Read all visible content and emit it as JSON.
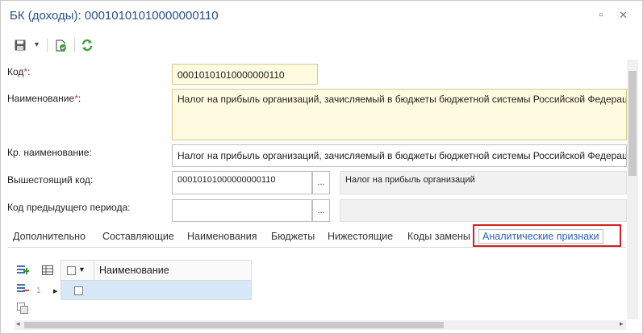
{
  "window": {
    "title": "БК (доходы): 00010101010000000110",
    "restore_glyph": "▫",
    "close_glyph": "✕"
  },
  "toolbar": {
    "save_icon": "save-icon",
    "dropdown_glyph": "▾",
    "approve_icon": "document-check-icon",
    "refresh_icon": "refresh-icon"
  },
  "form": {
    "code": {
      "label": "Код",
      "required_mark": "*",
      "suffix": ":",
      "value": "00010101010000000110"
    },
    "name": {
      "label": "Наименование",
      "required_mark": "*",
      "suffix": ":",
      "value": "Налог на прибыль организаций, зачисляемый в бюджеты бюджетной системы Российской Федерации"
    },
    "short_name": {
      "label": "Кр. наименование:",
      "value": "Налог на прибыль организаций, зачисляемый в бюджеты бюджетной системы Российской Федерации"
    },
    "parent_code": {
      "label": "Вышестоящий код:",
      "value": "00010101000000000110",
      "ellipsis": "...",
      "description": "Налог на прибыль организаций"
    },
    "prev_code": {
      "label": "Код предыдущего периода:",
      "value": "",
      "ellipsis": "...",
      "description": ""
    }
  },
  "tabs": [
    "Дополнительно",
    "Составляющие",
    "Наименования",
    "Бюджеты",
    "Нижестоящие",
    "Коды замены",
    "Аналитические признаки"
  ],
  "active_tab_index": 6,
  "grid": {
    "header_name": "Наименование",
    "row_number": "1",
    "row_arrow": "▸"
  },
  "colors": {
    "title": "#2b4f8a",
    "highlight_border": "#d61f1f",
    "active_tab_text": "#2d62b3",
    "required_field_bg": "#fffbe0",
    "selected_row_bg": "#d7e9f8"
  }
}
